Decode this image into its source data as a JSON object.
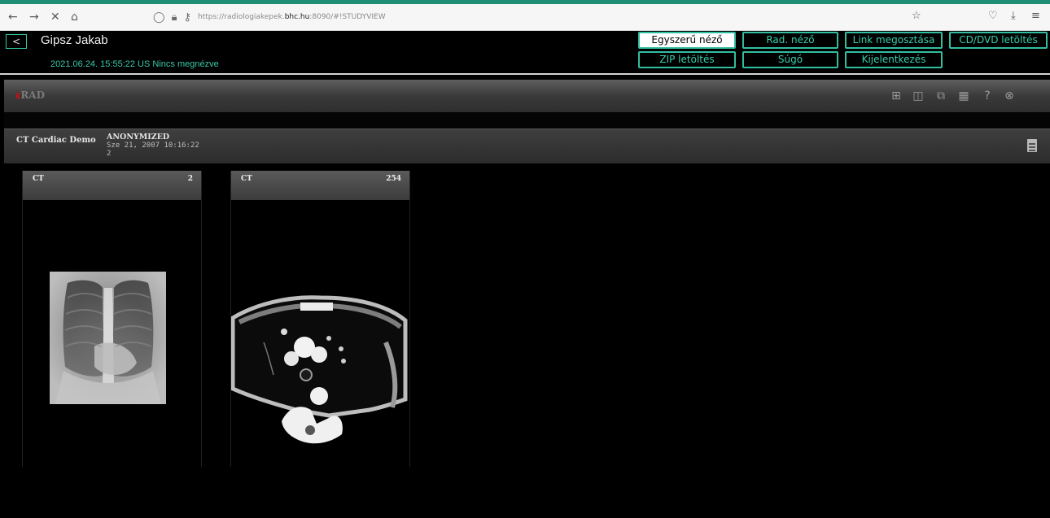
{
  "browser": {
    "url_prefix": "https://radiologiakepek.",
    "url_domain": "bhc.hu",
    "url_suffix": ":8090/#!STUDYVIEW",
    "icons": [
      "back-icon",
      "forward-icon",
      "close-icon",
      "home-icon",
      "shield-icon",
      "lock-icon",
      "key-icon",
      "star-icon",
      "pocket-icon",
      "download-icon",
      "menu-icon"
    ]
  },
  "header": {
    "back_label": "<",
    "patient_name": "Gipsz Jakab",
    "study_info": "2021.06.24. 15:55:22 US Nincs megnézve",
    "buttons": {
      "simple_viewer": "Egyszerű néző",
      "rad_viewer": "Rad. néző",
      "link_share": "Link megosztása",
      "cd_download": "CD/DVD letöltés",
      "zip_download": "ZIP letöltés",
      "help": "Súgó",
      "logout": "Kijelentkezés"
    }
  },
  "viewer": {
    "logo": "RAD",
    "study": {
      "description": "CT Cardiac Demo",
      "patient": "ANONYMIZED",
      "date": "Sze 21, 2007 10:16:22",
      "number": "2"
    },
    "series": [
      {
        "modality": "CT",
        "count": "2"
      },
      {
        "modality": "CT",
        "count": "254"
      }
    ]
  },
  "colors": {
    "accent": "#36c9a6",
    "topline": "#1f8f76"
  }
}
